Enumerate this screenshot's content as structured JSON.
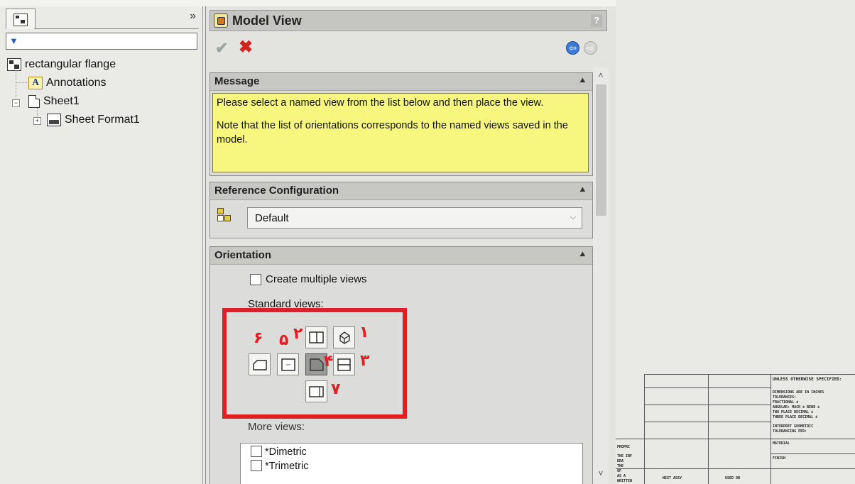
{
  "tree": {
    "collapse_glyph": "»",
    "filter_placeholder": "",
    "items": [
      {
        "label": "rectangular flange"
      },
      {
        "label": "Annotations"
      },
      {
        "label": "Sheet1"
      },
      {
        "label": "Sheet Format1"
      }
    ],
    "annotation_icon_letter": "A"
  },
  "property_manager": {
    "title": "Model View",
    "help": "?",
    "ok_glyph": "✔",
    "cancel_glyph": "✖",
    "back_glyph": "⇦",
    "next_glyph": "⇨",
    "groups": {
      "message": {
        "title": "Message",
        "text1": "Please select a named view from the list below and then place the view.",
        "text2": "Note that the list of orientations corresponds to the named views saved in the model."
      },
      "reference_configuration": {
        "title": "Reference Configuration",
        "selected": "Default"
      },
      "orientation": {
        "title": "Orientation",
        "create_multiple_views": "Create multiple views",
        "create_multiple_checked": false,
        "standard_views_label": "Standard views:",
        "more_views_label": "More views:",
        "more_views": [
          "*Dimetric",
          "*Trimetric"
        ]
      }
    },
    "collapse_glyph": "≈"
  },
  "annotations": {
    "color": "#e01e26",
    "numbers": [
      "۱",
      "۲",
      "۳",
      "۴",
      "۵",
      "۶",
      "۷"
    ]
  },
  "title_block": {
    "lines": [
      "UNLESS OTHERWISE SPECIFIED:",
      "DIMENSIONS ARE IN INCHES",
      "TOLERANCES:",
      "FRACTIONAL ±",
      "ANGULAR: MACH ±  BEND ±",
      "TWO PLACE DECIMAL  ±",
      "THREE PLACE DECIMAL  ±",
      "INTERPRET GEOMETRIC",
      "TOLERANCING PER:",
      "MATERIAL",
      "FINISH",
      "NEXT ASSY",
      "USED ON"
    ],
    "left_lines": [
      "PROPRI",
      "THE INF",
      "DRA",
      "THE",
      "OF",
      "AS A",
      "WRITTEN"
    ]
  }
}
